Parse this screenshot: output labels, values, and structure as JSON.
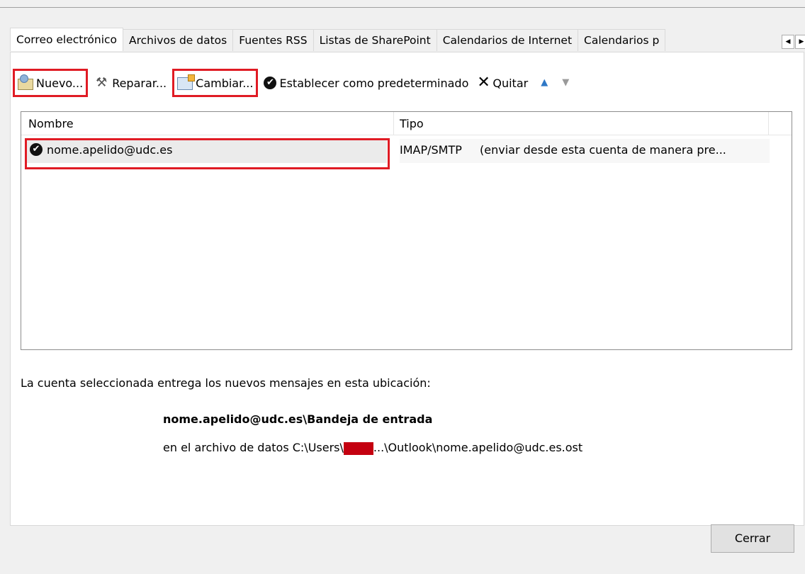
{
  "tabs": [
    "Correo electrónico",
    "Archivos de datos",
    "Fuentes RSS",
    "Listas de SharePoint",
    "Calendarios de Internet",
    "Calendarios p"
  ],
  "tab_scroll": {
    "left_icon": "chevron-left-icon",
    "right_icon": "chevron-right-icon"
  },
  "toolbar": {
    "new_label": "Nuevo...",
    "repair_label": "Reparar...",
    "change_label": "Cambiar...",
    "default_label": "Establecer como predeterminado",
    "remove_label": "Quitar"
  },
  "list": {
    "col_name": "Nombre",
    "col_type": "Tipo",
    "rows": [
      {
        "name": "nome.apelido@udc.es",
        "type": "IMAP/SMTP",
        "type_desc": "(enviar desde esta cuenta de manera pre..."
      }
    ]
  },
  "info_text": "La cuenta seleccionada entrega los nuevos mensajes en esta ubicación:",
  "destination": "nome.apelido@udc.es\\Bandeja de entrada",
  "path_prefix": "en el archivo de datos C:\\Users\\",
  "path_suffix": "...\\Outlook\\nome.apelido@udc.es.ost",
  "close_label": "Cerrar",
  "colors": {
    "highlight": "#e01b24",
    "redaction": "#c40010",
    "arrow_up": "#2f78c6"
  }
}
